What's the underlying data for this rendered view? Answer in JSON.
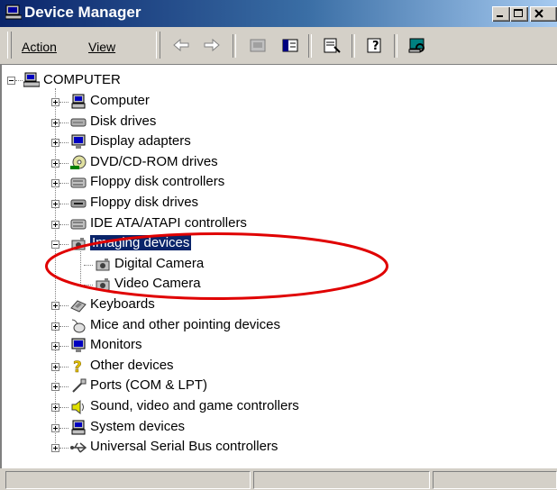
{
  "window": {
    "title": "Device Manager"
  },
  "menu": {
    "action": "Action",
    "view": "View"
  },
  "tree": {
    "root": "COMPUTER",
    "categories": [
      {
        "label": "Computer",
        "icon": "computer-icon"
      },
      {
        "label": "Disk drives",
        "icon": "disk-drive-icon"
      },
      {
        "label": "Display adapters",
        "icon": "monitor-icon"
      },
      {
        "label": "DVD/CD-ROM drives",
        "icon": "cdrom-icon"
      },
      {
        "label": "Floppy disk controllers",
        "icon": "controller-icon"
      },
      {
        "label": "Floppy disk drives",
        "icon": "floppy-drive-icon"
      },
      {
        "label": "IDE ATA/ATAPI controllers",
        "icon": "controller-icon"
      },
      {
        "label": "Imaging devices",
        "icon": "camera-icon",
        "expanded": true,
        "selected": true,
        "children": [
          {
            "label": "Digital Camera"
          },
          {
            "label": "Video Camera"
          }
        ]
      },
      {
        "label": "Keyboards",
        "icon": "keyboard-icon"
      },
      {
        "label": "Mice and other pointing devices",
        "icon": "mouse-icon"
      },
      {
        "label": "Monitors",
        "icon": "monitor-icon"
      },
      {
        "label": "Other devices",
        "icon": "question-icon"
      },
      {
        "label": "Ports (COM & LPT)",
        "icon": "port-icon"
      },
      {
        "label": "Sound, video and game controllers",
        "icon": "speaker-icon"
      },
      {
        "label": "System devices",
        "icon": "computer-icon"
      },
      {
        "label": "Universal Serial Bus controllers",
        "icon": "usb-icon"
      }
    ]
  },
  "colors": {
    "titlebar": "#0a246a",
    "selection": "#0a246a",
    "annotation": "#e00000",
    "face": "#d4d0c8"
  }
}
